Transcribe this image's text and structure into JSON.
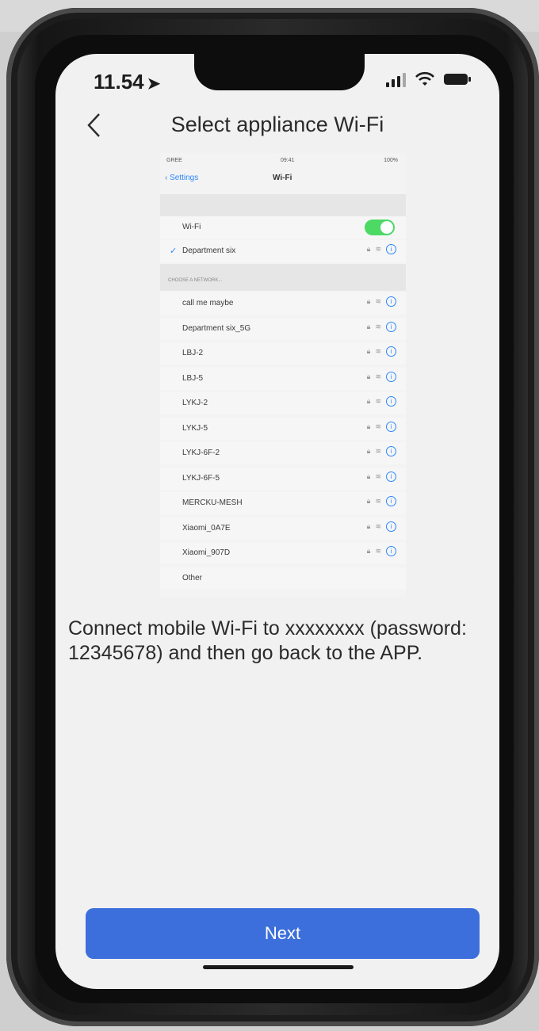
{
  "status_bar": {
    "time": "11.54"
  },
  "header": {
    "title": "Select appliance Wi-Fi"
  },
  "embedded_screenshot": {
    "status_left": "GREE",
    "status_time": "09:41",
    "status_right": "100%",
    "nav_back": "Settings",
    "nav_title": "Wi-Fi",
    "wifi_label": "Wi-Fi",
    "connected_network": "Department six",
    "choose_network_label": "CHOOSE A NETWORK...",
    "networks": [
      "call me maybe",
      "Department six_5G",
      "LBJ-2",
      "LBJ-5",
      "LYKJ-2",
      "LYKJ-5",
      "LYKJ-6F-2",
      "LYKJ-6F-5",
      "MERCKU-MESH",
      "Xiaomi_0A7E",
      "Xiaomi_907D",
      "Other"
    ]
  },
  "instruction": "Connect mobile Wi-Fi to xxxxxxxx (password: 12345678) and then go back to the APP.",
  "footer": {
    "next_label": "Next"
  },
  "colors": {
    "accent": "#3d6fdc",
    "toggle_on": "#4cd964",
    "ios_link": "#2a86ff"
  },
  "icons": [
    "back-chevron-icon",
    "location-arrow-icon",
    "signal-icon",
    "wifi-icon",
    "battery-icon",
    "lock-icon",
    "info-icon",
    "checkmark-icon"
  ]
}
